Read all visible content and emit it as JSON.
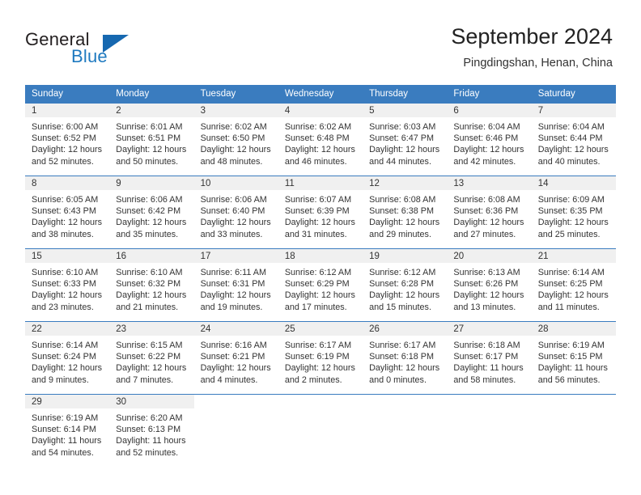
{
  "brand": {
    "name_top": "General",
    "name_bottom": "Blue",
    "triangle_color": "#1668b0",
    "blue_color": "#1f7ac0"
  },
  "header": {
    "month_title": "September 2024",
    "location": "Pingdingshan, Henan, China"
  },
  "calendar": {
    "header_bg": "#3a7cbf",
    "daynum_bg": "#f0f0f0",
    "weekday_headers": [
      "Sunday",
      "Monday",
      "Tuesday",
      "Wednesday",
      "Thursday",
      "Friday",
      "Saturday"
    ],
    "weeks": [
      [
        {
          "day": "1",
          "sunrise": "Sunrise: 6:00 AM",
          "sunset": "Sunset: 6:52 PM",
          "daylight_a": "Daylight: 12 hours",
          "daylight_b": "and 52 minutes."
        },
        {
          "day": "2",
          "sunrise": "Sunrise: 6:01 AM",
          "sunset": "Sunset: 6:51 PM",
          "daylight_a": "Daylight: 12 hours",
          "daylight_b": "and 50 minutes."
        },
        {
          "day": "3",
          "sunrise": "Sunrise: 6:02 AM",
          "sunset": "Sunset: 6:50 PM",
          "daylight_a": "Daylight: 12 hours",
          "daylight_b": "and 48 minutes."
        },
        {
          "day": "4",
          "sunrise": "Sunrise: 6:02 AM",
          "sunset": "Sunset: 6:48 PM",
          "daylight_a": "Daylight: 12 hours",
          "daylight_b": "and 46 minutes."
        },
        {
          "day": "5",
          "sunrise": "Sunrise: 6:03 AM",
          "sunset": "Sunset: 6:47 PM",
          "daylight_a": "Daylight: 12 hours",
          "daylight_b": "and 44 minutes."
        },
        {
          "day": "6",
          "sunrise": "Sunrise: 6:04 AM",
          "sunset": "Sunset: 6:46 PM",
          "daylight_a": "Daylight: 12 hours",
          "daylight_b": "and 42 minutes."
        },
        {
          "day": "7",
          "sunrise": "Sunrise: 6:04 AM",
          "sunset": "Sunset: 6:44 PM",
          "daylight_a": "Daylight: 12 hours",
          "daylight_b": "and 40 minutes."
        }
      ],
      [
        {
          "day": "8",
          "sunrise": "Sunrise: 6:05 AM",
          "sunset": "Sunset: 6:43 PM",
          "daylight_a": "Daylight: 12 hours",
          "daylight_b": "and 38 minutes."
        },
        {
          "day": "9",
          "sunrise": "Sunrise: 6:06 AM",
          "sunset": "Sunset: 6:42 PM",
          "daylight_a": "Daylight: 12 hours",
          "daylight_b": "and 35 minutes."
        },
        {
          "day": "10",
          "sunrise": "Sunrise: 6:06 AM",
          "sunset": "Sunset: 6:40 PM",
          "daylight_a": "Daylight: 12 hours",
          "daylight_b": "and 33 minutes."
        },
        {
          "day": "11",
          "sunrise": "Sunrise: 6:07 AM",
          "sunset": "Sunset: 6:39 PM",
          "daylight_a": "Daylight: 12 hours",
          "daylight_b": "and 31 minutes."
        },
        {
          "day": "12",
          "sunrise": "Sunrise: 6:08 AM",
          "sunset": "Sunset: 6:38 PM",
          "daylight_a": "Daylight: 12 hours",
          "daylight_b": "and 29 minutes."
        },
        {
          "day": "13",
          "sunrise": "Sunrise: 6:08 AM",
          "sunset": "Sunset: 6:36 PM",
          "daylight_a": "Daylight: 12 hours",
          "daylight_b": "and 27 minutes."
        },
        {
          "day": "14",
          "sunrise": "Sunrise: 6:09 AM",
          "sunset": "Sunset: 6:35 PM",
          "daylight_a": "Daylight: 12 hours",
          "daylight_b": "and 25 minutes."
        }
      ],
      [
        {
          "day": "15",
          "sunrise": "Sunrise: 6:10 AM",
          "sunset": "Sunset: 6:33 PM",
          "daylight_a": "Daylight: 12 hours",
          "daylight_b": "and 23 minutes."
        },
        {
          "day": "16",
          "sunrise": "Sunrise: 6:10 AM",
          "sunset": "Sunset: 6:32 PM",
          "daylight_a": "Daylight: 12 hours",
          "daylight_b": "and 21 minutes."
        },
        {
          "day": "17",
          "sunrise": "Sunrise: 6:11 AM",
          "sunset": "Sunset: 6:31 PM",
          "daylight_a": "Daylight: 12 hours",
          "daylight_b": "and 19 minutes."
        },
        {
          "day": "18",
          "sunrise": "Sunrise: 6:12 AM",
          "sunset": "Sunset: 6:29 PM",
          "daylight_a": "Daylight: 12 hours",
          "daylight_b": "and 17 minutes."
        },
        {
          "day": "19",
          "sunrise": "Sunrise: 6:12 AM",
          "sunset": "Sunset: 6:28 PM",
          "daylight_a": "Daylight: 12 hours",
          "daylight_b": "and 15 minutes."
        },
        {
          "day": "20",
          "sunrise": "Sunrise: 6:13 AM",
          "sunset": "Sunset: 6:26 PM",
          "daylight_a": "Daylight: 12 hours",
          "daylight_b": "and 13 minutes."
        },
        {
          "day": "21",
          "sunrise": "Sunrise: 6:14 AM",
          "sunset": "Sunset: 6:25 PM",
          "daylight_a": "Daylight: 12 hours",
          "daylight_b": "and 11 minutes."
        }
      ],
      [
        {
          "day": "22",
          "sunrise": "Sunrise: 6:14 AM",
          "sunset": "Sunset: 6:24 PM",
          "daylight_a": "Daylight: 12 hours",
          "daylight_b": "and 9 minutes."
        },
        {
          "day": "23",
          "sunrise": "Sunrise: 6:15 AM",
          "sunset": "Sunset: 6:22 PM",
          "daylight_a": "Daylight: 12 hours",
          "daylight_b": "and 7 minutes."
        },
        {
          "day": "24",
          "sunrise": "Sunrise: 6:16 AM",
          "sunset": "Sunset: 6:21 PM",
          "daylight_a": "Daylight: 12 hours",
          "daylight_b": "and 4 minutes."
        },
        {
          "day": "25",
          "sunrise": "Sunrise: 6:17 AM",
          "sunset": "Sunset: 6:19 PM",
          "daylight_a": "Daylight: 12 hours",
          "daylight_b": "and 2 minutes."
        },
        {
          "day": "26",
          "sunrise": "Sunrise: 6:17 AM",
          "sunset": "Sunset: 6:18 PM",
          "daylight_a": "Daylight: 12 hours",
          "daylight_b": "and 0 minutes."
        },
        {
          "day": "27",
          "sunrise": "Sunrise: 6:18 AM",
          "sunset": "Sunset: 6:17 PM",
          "daylight_a": "Daylight: 11 hours",
          "daylight_b": "and 58 minutes."
        },
        {
          "day": "28",
          "sunrise": "Sunrise: 6:19 AM",
          "sunset": "Sunset: 6:15 PM",
          "daylight_a": "Daylight: 11 hours",
          "daylight_b": "and 56 minutes."
        }
      ],
      [
        {
          "day": "29",
          "sunrise": "Sunrise: 6:19 AM",
          "sunset": "Sunset: 6:14 PM",
          "daylight_a": "Daylight: 11 hours",
          "daylight_b": "and 54 minutes."
        },
        {
          "day": "30",
          "sunrise": "Sunrise: 6:20 AM",
          "sunset": "Sunset: 6:13 PM",
          "daylight_a": "Daylight: 11 hours",
          "daylight_b": "and 52 minutes."
        },
        null,
        null,
        null,
        null,
        null
      ]
    ]
  }
}
